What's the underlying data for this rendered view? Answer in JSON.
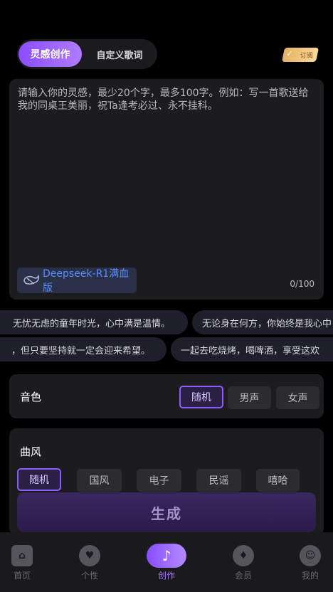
{
  "header": {
    "tab_active": "灵感创作",
    "tab_inactive": "自定义歌词",
    "subscribe_label": "订阅"
  },
  "prompt": {
    "placeholder": "请输入你的灵感，最少20个字，最多100字。例如：写一首歌送给我的同桌王美丽，祝Ta逢考必过、永不挂科。",
    "model_label": "Deepseek-R1满血版",
    "counter": "0/100"
  },
  "inspirations": [
    "无忧无虑的童年时光，心中满是温情。",
    "无论身在何方，你始终是我心中",
    "，但只要坚持就一定会迎来希望。",
    "一起去吃烧烤，喝啤酒，享受这欢"
  ],
  "voice": {
    "title": "音色",
    "options": [
      "随机",
      "男声",
      "女声"
    ],
    "selected": "随机"
  },
  "style": {
    "title": "曲风",
    "options": [
      "随机",
      "国风",
      "电子",
      "民谣",
      "嘻哈"
    ],
    "selected": "随机"
  },
  "generate_label": "生成",
  "tabbar": {
    "items": [
      "首页",
      "个性",
      "创作",
      "会员",
      "我的"
    ],
    "active": "创作"
  },
  "colors": {
    "accent": "#9b6bff",
    "model_badge_text": "#5b8cff",
    "subscribe_gold": "#f0c77a"
  }
}
